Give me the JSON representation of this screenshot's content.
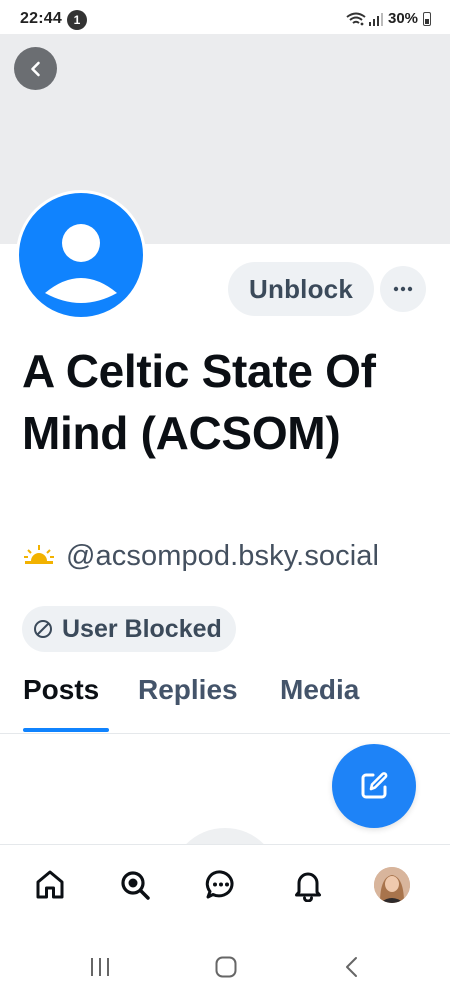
{
  "status_bar": {
    "time": "22:44",
    "notification_count": "1",
    "battery": "30%"
  },
  "profile": {
    "display_name": "A Celtic State Of Mind (ACSOM)",
    "handle": "@acsompod.bsky.social",
    "blocked_label": "User Blocked"
  },
  "actions": {
    "unblock_label": "Unblock",
    "more_label": "···"
  },
  "tabs": [
    {
      "label": "Posts",
      "active": true
    },
    {
      "label": "Replies",
      "active": false
    },
    {
      "label": "Media",
      "active": false
    }
  ],
  "bottom_nav": {
    "items": [
      "home-icon",
      "search-icon",
      "chat-icon",
      "bell-icon",
      "profile-avatar"
    ]
  },
  "colors": {
    "accent": "#1083fe",
    "fab": "#1e83f7",
    "banner": "#ebecee",
    "pill": "#eef1f4",
    "muted_text": "#44546a"
  }
}
